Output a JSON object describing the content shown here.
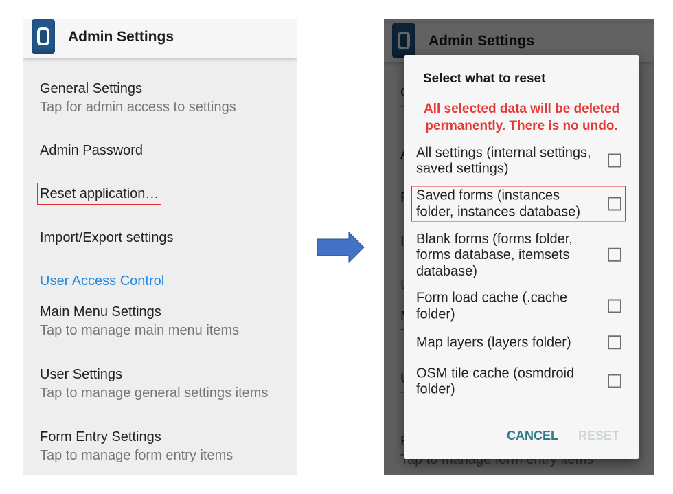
{
  "screen": {
    "title": "Admin Settings",
    "app_icon": "app-logo-icon",
    "items": [
      {
        "title": "General Settings",
        "summary": "Tap for admin access to settings"
      },
      {
        "title": "Admin Password"
      },
      {
        "title": "Reset application…",
        "highlighted": true
      },
      {
        "title": "Import/Export settings"
      },
      {
        "category": "User Access Control"
      },
      {
        "title": "Main Menu Settings",
        "summary": "Tap to manage main menu items"
      },
      {
        "title": "User Settings",
        "summary": "Tap to manage general settings items"
      },
      {
        "title": "Form Entry Settings",
        "summary": "Tap to manage form entry items"
      }
    ]
  },
  "transition_arrow": {
    "icon": "right-arrow-icon"
  },
  "reset_dialog": {
    "title": "Select what to reset",
    "warning": "All selected data will be deleted permanently. There is no undo.",
    "options": [
      {
        "label": "All settings (internal settings, saved settings)",
        "checked": false
      },
      {
        "label": "Saved forms (instances folder, instances database)",
        "checked": false,
        "highlighted": true
      },
      {
        "label": "Blank forms (forms folder, forms database, itemsets database)",
        "checked": false
      },
      {
        "label": "Form load cache (.cache folder)",
        "checked": false
      },
      {
        "label": "Map layers (layers folder)",
        "checked": false
      },
      {
        "label": "OSM tile cache (osmdroid folder)",
        "checked": false
      }
    ],
    "cancel_label": "CANCEL",
    "reset_label": "RESET",
    "reset_enabled": false
  },
  "colors": {
    "accent": "#2389e0",
    "warning": "#e53935",
    "dialog_button": "#2f7c88",
    "disabled_button": "#cdd5d8",
    "highlight_outline": "#e2303a",
    "app_icon": "#22578a",
    "arrow": "#4472c4"
  }
}
